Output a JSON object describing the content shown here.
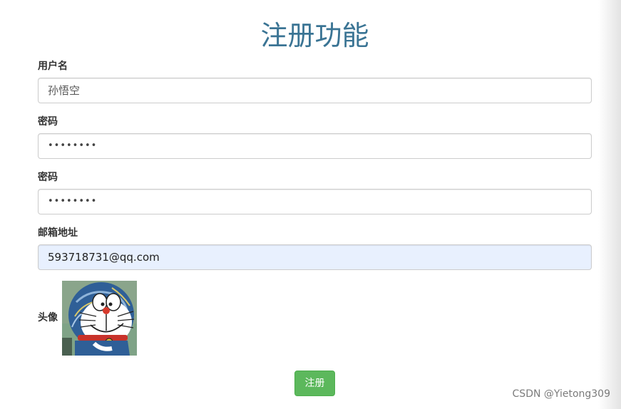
{
  "page": {
    "title": "注册功能"
  },
  "form": {
    "username": {
      "label": "用户名",
      "value": "孙悟空"
    },
    "password": {
      "label": "密码",
      "value": "••••••••"
    },
    "password_confirm": {
      "label": "密码",
      "value": "••••••••"
    },
    "email": {
      "label": "邮箱地址",
      "value": "593718731@qq.com"
    },
    "avatar": {
      "label": "头像",
      "icon": "doraemon-avatar-image"
    },
    "submit_label": "注册",
    "submit_color": "#5cb85c"
  },
  "watermark": "CSDN @Yietong309",
  "colors": {
    "title": "#3a7494",
    "autofill": "#e8f0fe"
  }
}
